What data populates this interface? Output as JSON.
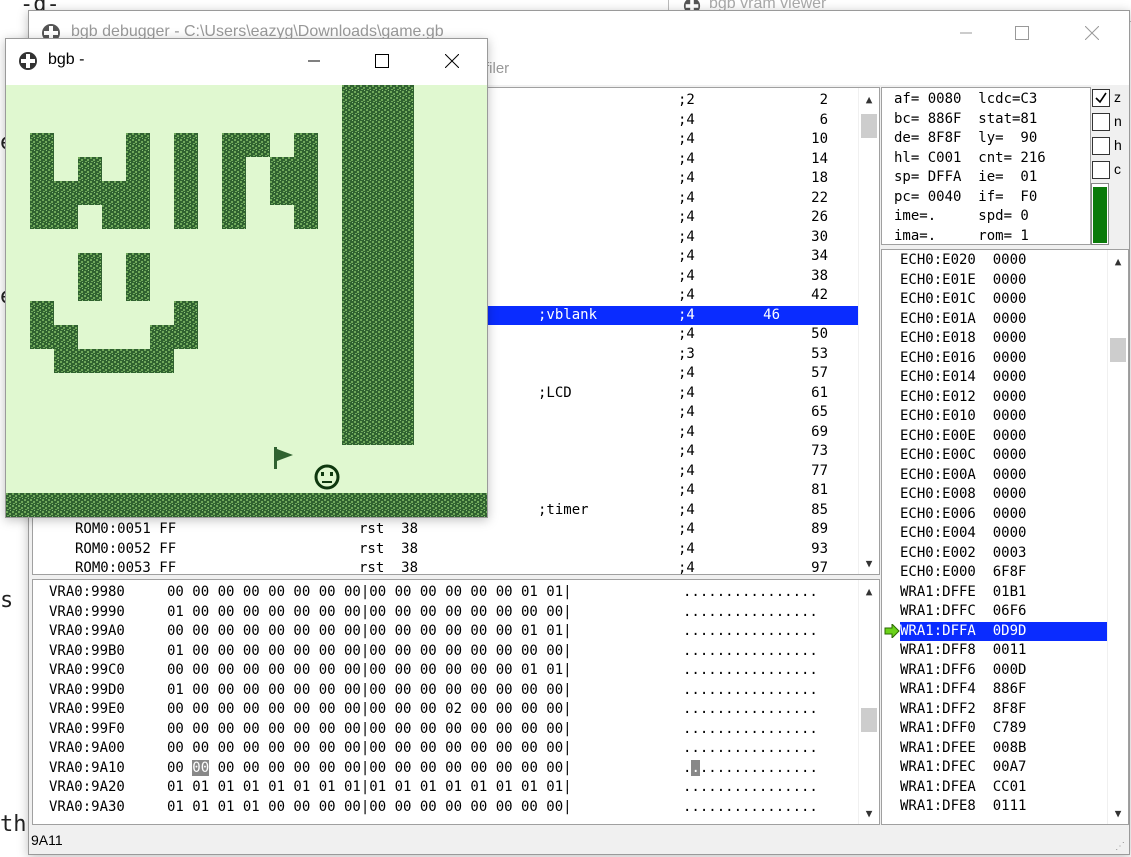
{
  "background_text": {
    "g": "-g-",
    "e1": "e",
    "e2": "e",
    "s": "s",
    "th": "th"
  },
  "vram_viewer": {
    "title": "bgb vram viewer"
  },
  "debugger": {
    "title": "bgb debugger - C:\\Users\\eazyg\\Downloads\\game.gb",
    "menu_partial": "filer",
    "disasm_rows": [
      {
        "left": "",
        "comment": "",
        "cyc": ";2",
        "tot": "2"
      },
      {
        "left": "",
        "comment": "",
        "cyc": ";4",
        "tot": "6"
      },
      {
        "left": "",
        "comment": "",
        "cyc": ";4",
        "tot": "10"
      },
      {
        "left": "",
        "comment": "",
        "cyc": ";4",
        "tot": "14"
      },
      {
        "left": "",
        "comment": "",
        "cyc": ";4",
        "tot": "18"
      },
      {
        "left": "",
        "comment": "",
        "cyc": ";4",
        "tot": "22"
      },
      {
        "left": "",
        "comment": "",
        "cyc": ";4",
        "tot": "26"
      },
      {
        "left": "",
        "comment": "",
        "cyc": ";4",
        "tot": "30"
      },
      {
        "left": "",
        "comment": "",
        "cyc": ";4",
        "tot": "34"
      },
      {
        "left": "",
        "comment": "",
        "cyc": ";4",
        "tot": "38"
      },
      {
        "left": "",
        "comment": "",
        "cyc": ";4",
        "tot": "42"
      },
      {
        "left": "",
        "comment": ";vblank",
        "cyc": ";4",
        "tot": "46",
        "selected": true
      },
      {
        "left": "",
        "comment": "",
        "cyc": ";4",
        "tot": "50"
      },
      {
        "left": "",
        "comment": "",
        "cyc": ";3",
        "tot": "53"
      },
      {
        "left": "",
        "comment": "",
        "cyc": ";4",
        "tot": "57"
      },
      {
        "left": "",
        "comment": ";LCD",
        "cyc": ";4",
        "tot": "61"
      },
      {
        "left": "",
        "comment": "",
        "cyc": ";4",
        "tot": "65"
      },
      {
        "left": "",
        "comment": "",
        "cyc": ";4",
        "tot": "69"
      },
      {
        "left": "",
        "comment": "",
        "cyc": ";4",
        "tot": "73"
      },
      {
        "left": "",
        "comment": "",
        "cyc": ";4",
        "tot": "77"
      },
      {
        "left": "",
        "comment": "",
        "cyc": ";4",
        "tot": "81"
      },
      {
        "left": "",
        "comment": ";timer",
        "cyc": ";4",
        "tot": "85"
      },
      {
        "left": "ROM0:0051 FF",
        "instr": "rst  38",
        "comment": "",
        "cyc": ";4",
        "tot": "89"
      },
      {
        "left": "ROM0:0052 FF",
        "instr": "rst  38",
        "comment": "",
        "cyc": ";4",
        "tot": "93"
      },
      {
        "left": "ROM0:0053 FF",
        "instr": "rst  38",
        "comment": "",
        "cyc": ";4",
        "tot": "97"
      }
    ],
    "registers": [
      "af= 0080  lcdc=C3",
      "bc= 886F  stat=81",
      "de= 8F8F  ly=  90",
      "hl= C001  cnt= 216",
      "sp= DFFA  ie=  01",
      "pc= 0040  if=  F0",
      "ime=.     spd= 0",
      "ima=.     rom= 1"
    ],
    "flags": [
      {
        "label": "z",
        "checked": true
      },
      {
        "label": "n",
        "checked": false
      },
      {
        "label": "h",
        "checked": false
      },
      {
        "label": "c",
        "checked": false
      }
    ],
    "stack": [
      {
        "text": "ECH0:E020  0000"
      },
      {
        "text": "ECH0:E01E  0000"
      },
      {
        "text": "ECH0:E01C  0000"
      },
      {
        "text": "ECH0:E01A  0000"
      },
      {
        "text": "ECH0:E018  0000"
      },
      {
        "text": "ECH0:E016  0000"
      },
      {
        "text": "ECH0:E014  0000"
      },
      {
        "text": "ECH0:E012  0000"
      },
      {
        "text": "ECH0:E010  0000"
      },
      {
        "text": "ECH0:E00E  0000"
      },
      {
        "text": "ECH0:E00C  0000"
      },
      {
        "text": "ECH0:E00A  0000"
      },
      {
        "text": "ECH0:E008  0000"
      },
      {
        "text": "ECH0:E006  0000"
      },
      {
        "text": "ECH0:E004  0000"
      },
      {
        "text": "ECH0:E002  0003"
      },
      {
        "text": "ECH0:E000  6F8F"
      },
      {
        "text": "WRA1:DFFE  01B1"
      },
      {
        "text": "WRA1:DFFC  06F6"
      },
      {
        "text": "WRA1:DFFA  0D9D",
        "current": true
      },
      {
        "text": "WRA1:DFF8  0011"
      },
      {
        "text": "WRA1:DFF6  000D"
      },
      {
        "text": "WRA1:DFF4  886F"
      },
      {
        "text": "WRA1:DFF2  8F8F"
      },
      {
        "text": "WRA1:DFF0  C789"
      },
      {
        "text": "WRA1:DFEE  008B"
      },
      {
        "text": "WRA1:DFEC  00A7"
      },
      {
        "text": "WRA1:DFEA  CC01"
      },
      {
        "text": "WRA1:DFE8  0111"
      }
    ],
    "memory": [
      {
        "addr": "VRA0:9980",
        "hex": "00 00 00 00 00 00 00 00|00 00 00 00 00 00 01 01|",
        "ascii": "................"
      },
      {
        "addr": "VRA0:9990",
        "hex": "01 00 00 00 00 00 00 00|00 00 00 00 00 00 00 00|",
        "ascii": "................"
      },
      {
        "addr": "VRA0:99A0",
        "hex": "00 00 00 00 00 00 00 00|00 00 00 00 00 00 01 01|",
        "ascii": "................"
      },
      {
        "addr": "VRA0:99B0",
        "hex": "01 00 00 00 00 00 00 00|00 00 00 00 00 00 00 00|",
        "ascii": "................"
      },
      {
        "addr": "VRA0:99C0",
        "hex": "00 00 00 00 00 00 00 00|00 00 00 00 00 00 01 01|",
        "ascii": "................"
      },
      {
        "addr": "VRA0:99D0",
        "hex": "01 00 00 00 00 00 00 00|00 00 00 00 00 00 00 00|",
        "ascii": "................"
      },
      {
        "addr": "VRA0:99E0",
        "hex": "00 00 00 00 00 00 00 00|00 00 00 02 00 00 00 00|",
        "ascii": "................"
      },
      {
        "addr": "VRA0:99F0",
        "hex": "00 00 00 00 00 00 00 00|00 00 00 00 00 00 00 00|",
        "ascii": "................"
      },
      {
        "addr": "VRA0:9A00",
        "hex": "00 00 00 00 00 00 00 00|00 00 00 00 00 00 00 00|",
        "ascii": "................"
      },
      {
        "addr": "VRA0:9A10",
        "hex_pre": "00 ",
        "hex_sel": "00",
        "hex_post": " 00 00 00 00 00 00|00 00 00 00 00 00 00 00|",
        "ascii_pre": ".",
        "ascii_sel": ".",
        "ascii_post": "..............",
        "cursor": true
      },
      {
        "addr": "VRA0:9A20",
        "hex": "01 01 01 01 01 01 01 01|01 01 01 01 01 01 01 01|",
        "ascii": "................"
      },
      {
        "addr": "VRA0:9A30",
        "hex": "01 01 01 01 00 00 00 00|00 00 00 00 00 00 00 00|",
        "ascii": "................"
      }
    ],
    "status": "9A11"
  },
  "game_window": {
    "title": "bgb -",
    "colors": {
      "light": "#e0f8d0",
      "dark": "#306230",
      "mid": "#5e9a4e"
    }
  }
}
